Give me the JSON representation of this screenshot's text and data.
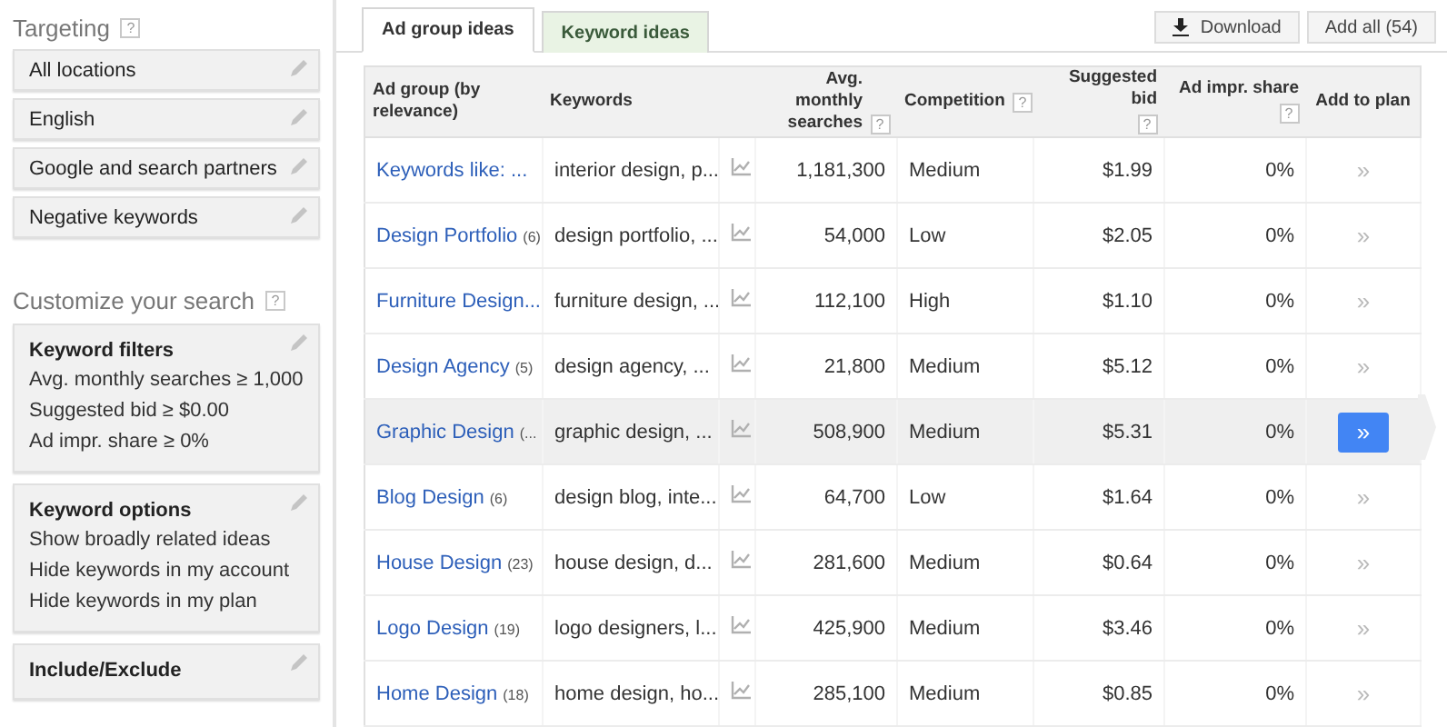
{
  "targeting": {
    "title": "Targeting",
    "help": "?",
    "items": [
      {
        "label": "All locations"
      },
      {
        "label": "English"
      },
      {
        "label": "Google and search partners"
      },
      {
        "label": "Negative keywords"
      }
    ]
  },
  "customize": {
    "title": "Customize your search",
    "help": "?",
    "sections": [
      {
        "title": "Keyword filters",
        "lines": [
          "Avg. monthly searches ≥ 1,000",
          "Suggested bid ≥ $0.00",
          "Ad impr. share ≥ 0%"
        ]
      },
      {
        "title": "Keyword options",
        "lines": [
          "Show broadly related ideas",
          "Hide keywords in my account",
          "Hide keywords in my plan"
        ]
      },
      {
        "title": "Include/Exclude"
      }
    ]
  },
  "tabs": [
    {
      "label": "Ad group ideas",
      "selected": true
    },
    {
      "label": "Keyword ideas",
      "selected": false
    }
  ],
  "actions": {
    "download": "Download",
    "add_all": "Add all (54)"
  },
  "table": {
    "columns": [
      {
        "label": "Ad group (by relevance)"
      },
      {
        "label": "Keywords"
      },
      {
        "label": "Avg. monthly searches",
        "help": "?"
      },
      {
        "label": "Competition",
        "help": "?"
      },
      {
        "label": "Suggested bid",
        "help": "?"
      },
      {
        "label": "Ad impr. share",
        "help": "?"
      },
      {
        "label": "Add to plan"
      }
    ],
    "rows": [
      {
        "ad_group": "Keywords like: ...",
        "keywords": "interior design, p...",
        "searches": "1,181,300",
        "competition": "Medium",
        "bid": "$1.99",
        "impr_share": "0%",
        "add": "»",
        "selected": false
      },
      {
        "ad_group": "Design Portfolio",
        "count": "(6)",
        "keywords": "design portfolio, ...",
        "searches": "54,000",
        "competition": "Low",
        "bid": "$2.05",
        "impr_share": "0%",
        "add": "»",
        "selected": false
      },
      {
        "ad_group": "Furniture Design...",
        "keywords": "furniture design, ...",
        "searches": "112,100",
        "competition": "High",
        "bid": "$1.10",
        "impr_share": "0%",
        "add": "»",
        "selected": false
      },
      {
        "ad_group": "Design Agency",
        "count": "(5)",
        "keywords": "design agency, ...",
        "searches": "21,800",
        "competition": "Medium",
        "bid": "$5.12",
        "impr_share": "0%",
        "add": "»",
        "selected": false
      },
      {
        "ad_group": "Graphic Design",
        "count": "(...",
        "keywords": "graphic design, ...",
        "searches": "508,900",
        "competition": "Medium",
        "bid": "$5.31",
        "impr_share": "0%",
        "add": "»",
        "selected": true
      },
      {
        "ad_group": "Blog Design",
        "count": "(6)",
        "keywords": "design blog, inte...",
        "searches": "64,700",
        "competition": "Low",
        "bid": "$1.64",
        "impr_share": "0%",
        "add": "»",
        "selected": false
      },
      {
        "ad_group": "House Design",
        "count": "(23)",
        "keywords": "house design, d...",
        "searches": "281,600",
        "competition": "Medium",
        "bid": "$0.64",
        "impr_share": "0%",
        "add": "»",
        "selected": false
      },
      {
        "ad_group": "Logo Design",
        "count": "(19)",
        "keywords": "logo designers, l...",
        "searches": "425,900",
        "competition": "Medium",
        "bid": "$3.46",
        "impr_share": "0%",
        "add": "»",
        "selected": false
      },
      {
        "ad_group": "Home Design",
        "count": "(18)",
        "keywords": "home design, ho...",
        "searches": "285,100",
        "competition": "Medium",
        "bid": "$0.85",
        "impr_share": "0%",
        "add": "»",
        "selected": false
      }
    ]
  }
}
